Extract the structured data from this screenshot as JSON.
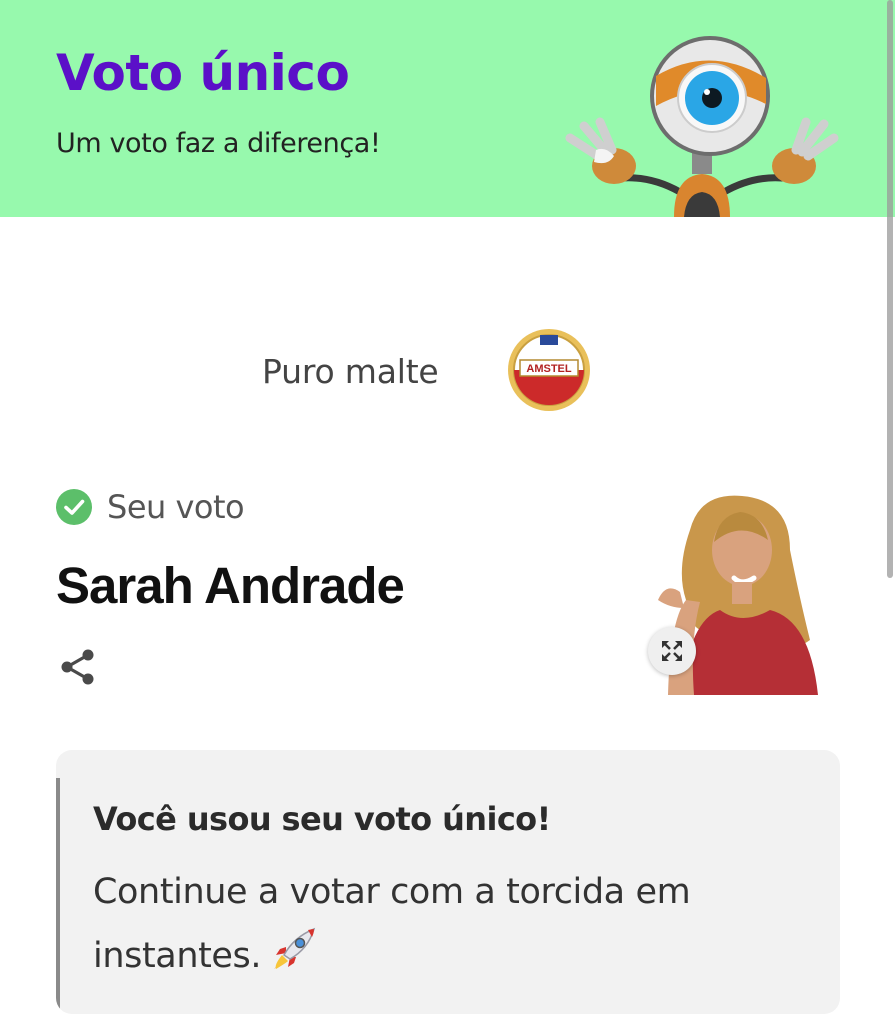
{
  "header": {
    "title": "Voto único",
    "subtitle": "Um voto faz a diferença!",
    "mascot_icon": "big-brother-eye-robot-mascot",
    "background_color": "#97f9ad",
    "title_color": "#5b10c8"
  },
  "sponsor": {
    "text": "Puro malte",
    "logo_icon": "amstel-lager-logo",
    "logo_text": "AMSTEL"
  },
  "vote": {
    "status_label": "Seu voto",
    "status_icon": "check-circle-icon",
    "status_color": "#5cbf6a",
    "participant_name": "Sarah Andrade",
    "share_icon": "share-icon",
    "expand_icon": "expand-icon"
  },
  "notice": {
    "title": "Você usou seu voto único!",
    "body": "Continue a votar com a torcida em instantes.",
    "emoji_icon": "rocket-icon"
  }
}
